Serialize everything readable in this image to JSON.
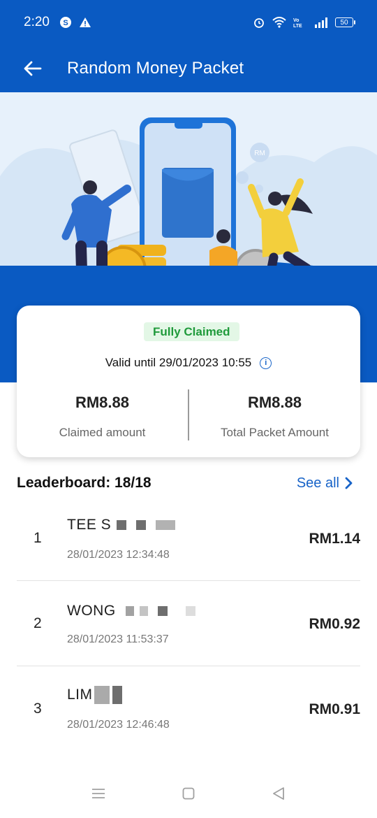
{
  "status_bar": {
    "time": "2:20",
    "battery": "50"
  },
  "header": {
    "title": "Random Money Packet"
  },
  "hero": {
    "coin_label": "RM",
    "coin_label_small": "RM"
  },
  "summary": {
    "status_badge": "Fully Claimed",
    "valid_until": "Valid until 29/01/2023 10:55",
    "claimed_value": "RM8.88",
    "claimed_label": "Claimed amount",
    "total_value": "RM8.88",
    "total_label": "Total Packet Amount"
  },
  "leaderboard": {
    "title": "Leaderboard: 18/18",
    "see_all": "See all",
    "entries": [
      {
        "rank": "1",
        "name": "TEE S",
        "time": "28/01/2023 12:34:48",
        "amount": "RM1.14"
      },
      {
        "rank": "2",
        "name": "WONG",
        "time": "28/01/2023 11:53:37",
        "amount": "RM0.92"
      },
      {
        "rank": "3",
        "name": "LIM",
        "time": "28/01/2023 12:46:48",
        "amount": "RM0.91"
      }
    ]
  },
  "colors": {
    "brand_blue": "#0a5ac2",
    "success_green": "#1f9a3b",
    "link_blue": "#1763c8"
  }
}
